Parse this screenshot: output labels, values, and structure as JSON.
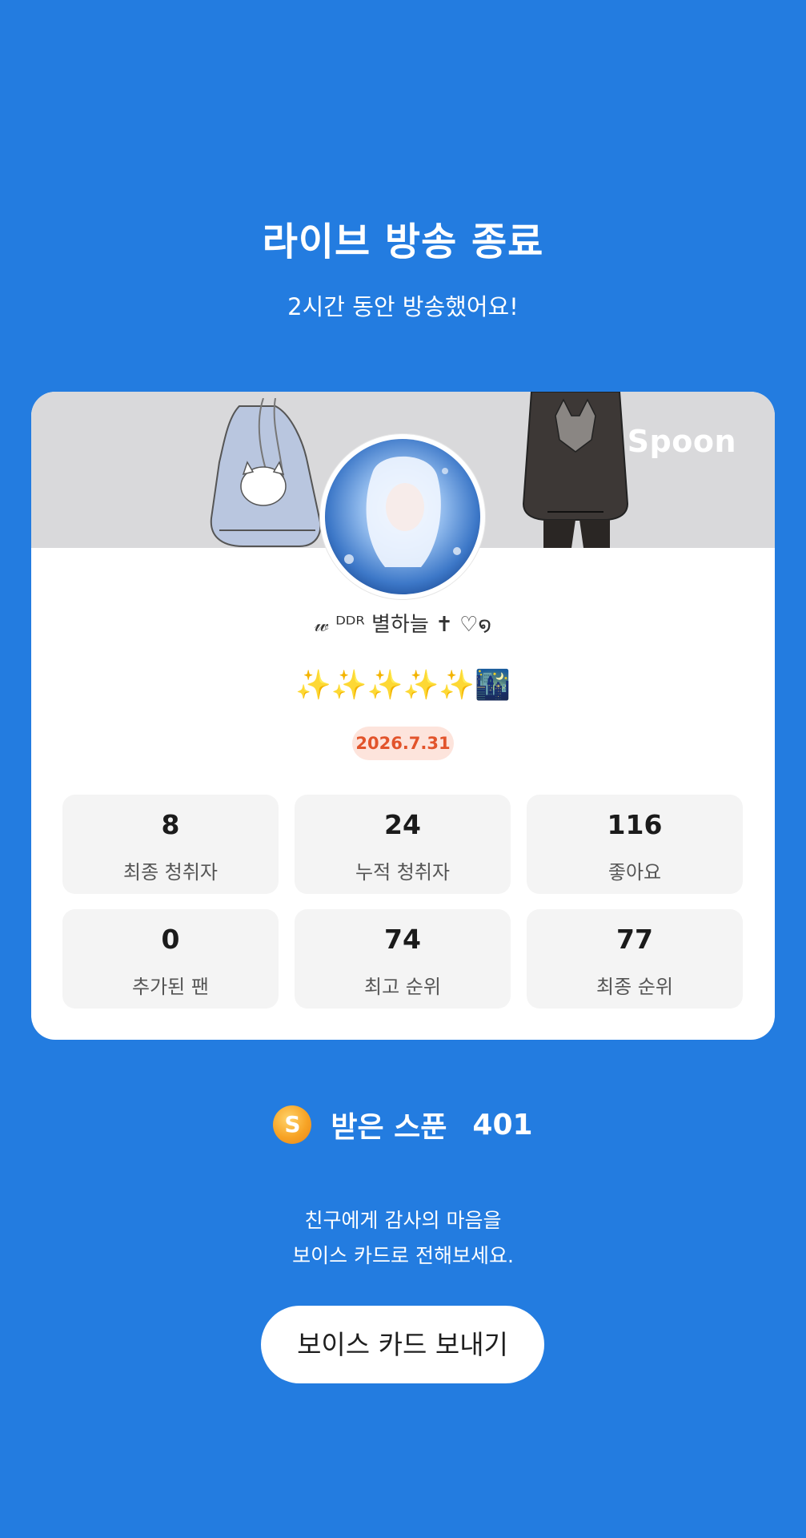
{
  "header": {
    "title": "라이브 방송 종료",
    "subtitle": "2시간 동안 방송했어요!"
  },
  "card": {
    "brand": "Spoon",
    "nickname": "𝓌 ᴰᴰᴿ 별하늘 ✝ ♡໑",
    "emoji_line": "✨✨✨✨✨🌃",
    "date": "2026.7.31",
    "stats": [
      {
        "value": "8",
        "label": "최종 청취자"
      },
      {
        "value": "24",
        "label": "누적 청취자"
      },
      {
        "value": "116",
        "label": "좋아요"
      },
      {
        "value": "0",
        "label": "추가된 팬"
      },
      {
        "value": "74",
        "label": "최고 순위"
      },
      {
        "value": "77",
        "label": "최종 순위"
      }
    ]
  },
  "spoons": {
    "coin_letter": "S",
    "label": "받은 스푼",
    "count": "401"
  },
  "thanks": {
    "line1": "친구에게 감사의 마음을",
    "line2": "보이스 카드로 전해보세요."
  },
  "voice_card_button": "보이스 카드 보내기",
  "colors": {
    "background": "#237ce0",
    "date_badge_bg": "#fde4dc",
    "date_badge_text": "#e2542b"
  }
}
